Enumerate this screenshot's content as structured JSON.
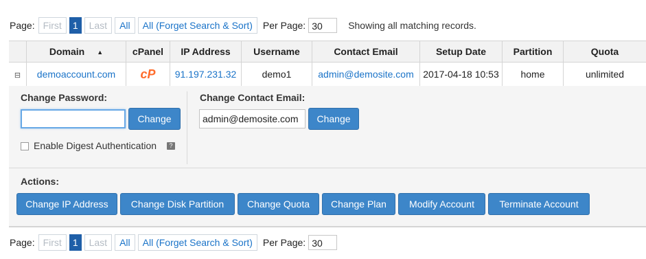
{
  "pager": {
    "page_label": "Page:",
    "first": "First",
    "current": "1",
    "last": "Last",
    "all": "All",
    "forget": "All (Forget Search & Sort)",
    "per_page_label": "Per Page:",
    "per_page_value": "30",
    "status": "Showing all matching records."
  },
  "table": {
    "headers": [
      "Domain",
      "cPanel",
      "IP Address",
      "Username",
      "Contact Email",
      "Setup Date",
      "Partition",
      "Quota"
    ],
    "row": {
      "expander": "⊟",
      "domain": "demoaccount.com",
      "cpanel_icon": "cP",
      "ip": "91.197.231.32",
      "username": "demo1",
      "email": "admin@demosite.com",
      "setup_date": "2017-04-18 10:53",
      "partition": "home",
      "quota": "unlimited"
    }
  },
  "panel": {
    "change_password_title": "Change Password:",
    "password_value": "",
    "change_button": "Change",
    "digest_label": "Enable Digest Authentication",
    "digest_checked": false,
    "change_email_title": "Change Contact Email:",
    "email_value": "admin@demosite.com",
    "email_change_button": "Change",
    "actions_title": "Actions:",
    "actions": [
      "Change IP Address",
      "Change Disk Partition",
      "Change Quota",
      "Change Plan",
      "Modify Account",
      "Terminate Account"
    ]
  },
  "icons": {
    "sort": "sort-ascending-icon",
    "help": "help-tooltip-icon",
    "cpanel": "cpanel-logo-icon"
  }
}
